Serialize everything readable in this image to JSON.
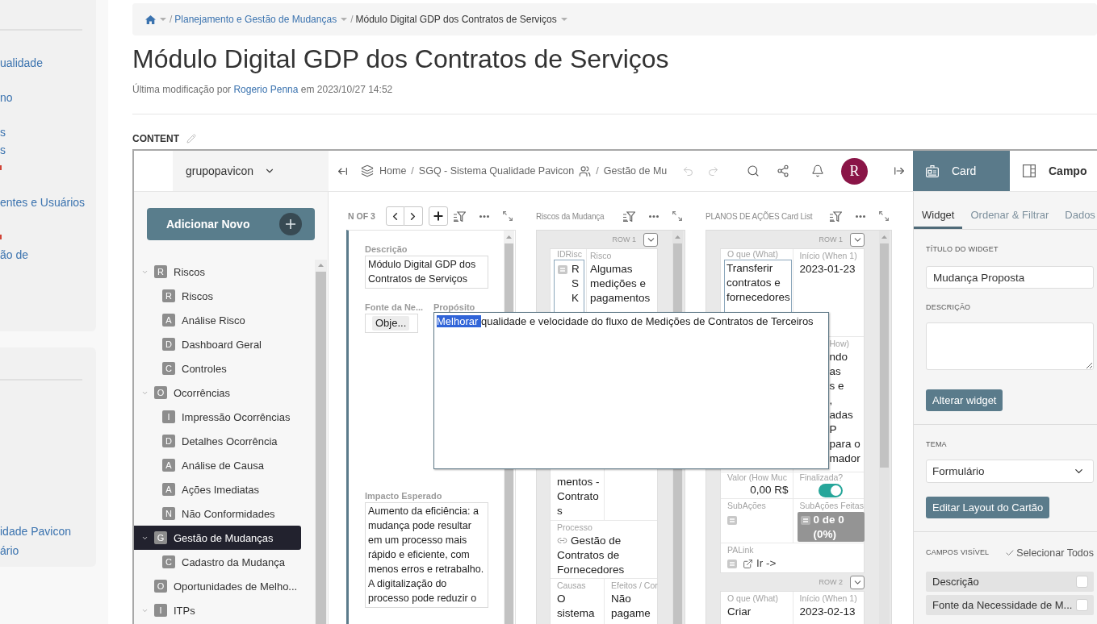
{
  "sidebar": {
    "panels": [
      {
        "link_groups": [
          {
            "links": [
              {
                "kind": "link",
                "text": "ualidade"
              }
            ]
          },
          {
            "links": [
              {
                "kind": "link",
                "text": "no"
              }
            ]
          },
          {
            "links": [
              {
                "kind": "link",
                "text": "s"
              },
              {
                "kind": "link",
                "text": "s"
              },
              {
                "kind": "mark"
              }
            ]
          },
          {
            "links": [
              {
                "kind": "link",
                "text": "entes e Usuários"
              }
            ]
          },
          {
            "links": [
              {
                "kind": "mark"
              },
              {
                "kind": "link",
                "text": "ão de"
              }
            ]
          }
        ]
      },
      {
        "link_groups": [
          {
            "links": [
              {
                "kind": "link",
                "text": "idade Pavicon"
              },
              {
                "kind": "link",
                "text": "ário"
              }
            ]
          }
        ]
      }
    ]
  },
  "breadcrumbs": {
    "separator": "/",
    "items": [
      {
        "kind": "home"
      },
      {
        "kind": "link",
        "text": "Planejamento e Gestão de Mudanças"
      },
      {
        "kind": "current",
        "text": "Módulo Digital GDP dos Contratos de Serviços"
      }
    ]
  },
  "page": {
    "title": "Módulo Digital GDP dos Contratos de Serviços",
    "byline": {
      "prefix": "Última modificação por",
      "author": "Rogerio Penna",
      "suffix": "em 2023/10/27 14:52"
    },
    "section_label": "CONTENT"
  },
  "app": {
    "workspace": "grupopavicon",
    "path": {
      "separator": "/",
      "items": [
        {
          "kind": "home",
          "text": "Home"
        },
        {
          "kind": "space",
          "text": "SGQ - Sistema Qualidade Pavicon"
        },
        {
          "kind": "page",
          "text": "Gestão de Mu"
        }
      ]
    },
    "history": {
      "undo_disabled": true,
      "redo_disabled": true
    },
    "avatar": "R",
    "panel_tabs": [
      {
        "kind": "card",
        "label": "Card",
        "selected": true
      },
      {
        "kind": "field",
        "label": "Campo",
        "selected": false
      }
    ],
    "add_button": "Adicionar Novo",
    "tree": [
      {
        "kind": "group",
        "badge": "R",
        "label": "Riscos",
        "expanded": true,
        "selected": false,
        "children": [
          {
            "badge": "R",
            "label": "Riscos",
            "selected": false
          },
          {
            "badge": "A",
            "label": "Análise Risco",
            "selected": false
          },
          {
            "badge": "D",
            "label": "Dashboard Geral",
            "selected": false
          },
          {
            "badge": "C",
            "label": "Controles",
            "selected": false
          }
        ]
      },
      {
        "kind": "group",
        "badge": "O",
        "label": "Ocorrências",
        "expanded": true,
        "selected": false,
        "children": [
          {
            "badge": "I",
            "label": "Impressão Ocorrências",
            "selected": false
          },
          {
            "badge": "D",
            "label": "Detalhes Ocorrência",
            "selected": false
          },
          {
            "badge": "A",
            "label": "Análise de Causa",
            "selected": false
          },
          {
            "badge": "A",
            "label": "Ações Imediatas",
            "selected": false
          },
          {
            "badge": "N",
            "label": "Não Conformidades",
            "selected": false
          }
        ]
      },
      {
        "kind": "group",
        "badge": "G",
        "label": "Gestão de Mudanças",
        "expanded": true,
        "selected": true,
        "children": [
          {
            "badge": "C",
            "label": "Cadastro da Mudança",
            "selected": false
          }
        ]
      },
      {
        "kind": "page",
        "badge": "O",
        "label": "Oportunidades de Melho...",
        "selected": false
      },
      {
        "kind": "group",
        "badge": "I",
        "label": "ITPs",
        "expanded": true,
        "selected": false
      }
    ],
    "widgets": [
      {
        "kind": "card_view",
        "pager": "N OF 3",
        "card": {
          "fields": [
            {
              "kind": "text",
              "label": "Descrição",
              "value": "Módulo Digital GDP dos Contratos de Serviços"
            },
            {
              "kind": "chip",
              "label": "Fonte da Ne...",
              "value": "Obje..."
            },
            {
              "kind": "label",
              "label": "Propósito"
            },
            {
              "kind": "text",
              "label": "Impacto Esperado",
              "value": "Aumento da eficiência: a mudança pode resultar em um processo mais rápido e eficiente, com menos erros e retrabalho. A digitalização do processo pode reduzir o"
            }
          ]
        }
      },
      {
        "kind": "card_list",
        "title": "Riscos da Mudança",
        "rows": [
          {
            "label": "ROW 1",
            "lines": [
              {
                "cells": [
                  {
                    "kind": "id",
                    "label": "IDRisc",
                    "value": "RSK"
                  },
                  {
                    "kind": "text",
                    "label": "Risco",
                    "value": "Algumas medições e pagamentos"
                  }
                ]
              },
              {
                "cells": [
                  {
                    "kind": "tail",
                    "value": "mentos - Contratos"
                  },
                  {
                    "kind": "blank"
                  }
                ]
              },
              {
                "cells": [
                  {
                    "kind": "link",
                    "label": "Processo",
                    "value": "Gestão de Contratos de Fornecedores"
                  }
                ]
              },
              {
                "cells": [
                  {
                    "kind": "text",
                    "label": "Causas",
                    "value": "O sistema"
                  },
                  {
                    "kind": "text",
                    "label": "Efeitos / Cor",
                    "value": "Não pagame"
                  }
                ]
              }
            ]
          }
        ]
      },
      {
        "kind": "card_list",
        "title": "PLANOS DE AÇÕES Card List",
        "rows": [
          {
            "label": "ROW 1",
            "lines": [
              {
                "cells": [
                  {
                    "kind": "boxed",
                    "label": "O que (What)",
                    "value": "Transferir contratos e fornecedores"
                  },
                  {
                    "kind": "text",
                    "label": "Início (When 1)",
                    "value": "2023-01-23"
                  }
                ]
              },
              {
                "cells": [
                  {
                    "kind": "blank"
                  },
                  {
                    "kind": "clipped",
                    "label": "How)",
                    "lines": [
                      "ndo",
                      "as",
                      "s e",
                      ",",
                      "adas",
                      "P",
                      "para o",
                      "mador"
                    ]
                  }
                ]
              },
              {
                "cells": [
                  {
                    "kind": "money",
                    "label": "Valor (How Muc",
                    "value": "0,00 R$"
                  },
                  {
                    "kind": "toggle",
                    "label": "Finalizada?",
                    "on": true
                  }
                ]
              },
              {
                "cells": [
                  {
                    "kind": "list",
                    "label": "SubAções"
                  },
                  {
                    "kind": "progress",
                    "label": "SubAções Feitas",
                    "value": "0 de 0 (0%)"
                  }
                ]
              },
              {
                "cells": [
                  {
                    "kind": "goto",
                    "label": "PALink",
                    "value": "Ir ->"
                  }
                ]
              }
            ]
          },
          {
            "label": "ROW 2",
            "lines": [
              {
                "cells": [
                  {
                    "kind": "text",
                    "label": "O que (What)",
                    "value": "Criar"
                  },
                  {
                    "kind": "text",
                    "label": "Início (When 1)",
                    "value": "2023-02-13"
                  }
                ]
              }
            ]
          }
        ]
      }
    ],
    "popup": {
      "selected_text": "Melhorar",
      "text": "qualidade e velocidade do fluxo de Medições de Contratos de Terceiros"
    },
    "settings": {
      "tabs": [
        {
          "label": "Widget",
          "selected": true
        },
        {
          "label": "Ordenar & Filtrar",
          "selected": false
        },
        {
          "label": "Dados",
          "selected": false
        }
      ],
      "fields": [
        {
          "kind": "input",
          "label": "TÍTULO DO WIDGET",
          "value": "Mudança Proposta"
        },
        {
          "kind": "textarea",
          "label": "DESCRIÇÃO"
        }
      ],
      "apply_button": "Alterar widget",
      "theme": {
        "label": "TEMA",
        "value": "Formulário"
      },
      "layout_button": "Editar Layout do Cartão",
      "visible_fields": {
        "label": "CAMPOS VISÍVEL",
        "select_all": "Selecionar Todos",
        "items": [
          {
            "label": "Descrição",
            "checked": false
          },
          {
            "label": "Fonte da Necessidade de M...",
            "checked": false
          }
        ]
      }
    }
  }
}
